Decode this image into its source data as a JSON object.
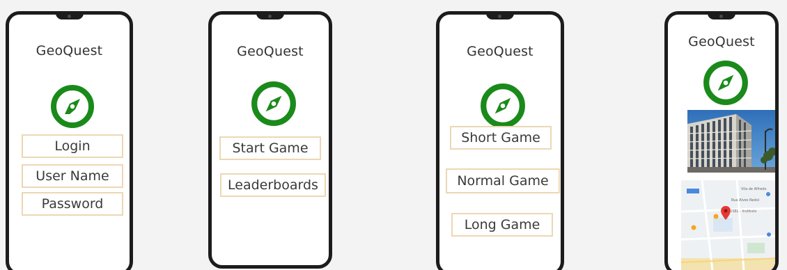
{
  "screens": [
    {
      "title": "GeoQuest",
      "buttons": [
        "Login",
        "User Name",
        "Password"
      ]
    },
    {
      "title": "GeoQuest",
      "buttons": [
        "Start Game",
        "Leaderboards"
      ]
    },
    {
      "title": "GeoQuest",
      "buttons": [
        "Short Game",
        "Normal Game",
        "Long Game"
      ]
    },
    {
      "title": "GeoQuest",
      "map_labels": [
        "Rua Alves Redol",
        "ISEL - Instituto",
        "Vila de Alfredo"
      ]
    }
  ],
  "colors": {
    "compass": "#1a8a1a",
    "button_border": "#ecd7b4",
    "phone_frame": "#1c1c1c",
    "map_pin": "#e53935"
  },
  "icons": {
    "logo": "compass-icon",
    "map_pin": "map-pin-icon"
  }
}
